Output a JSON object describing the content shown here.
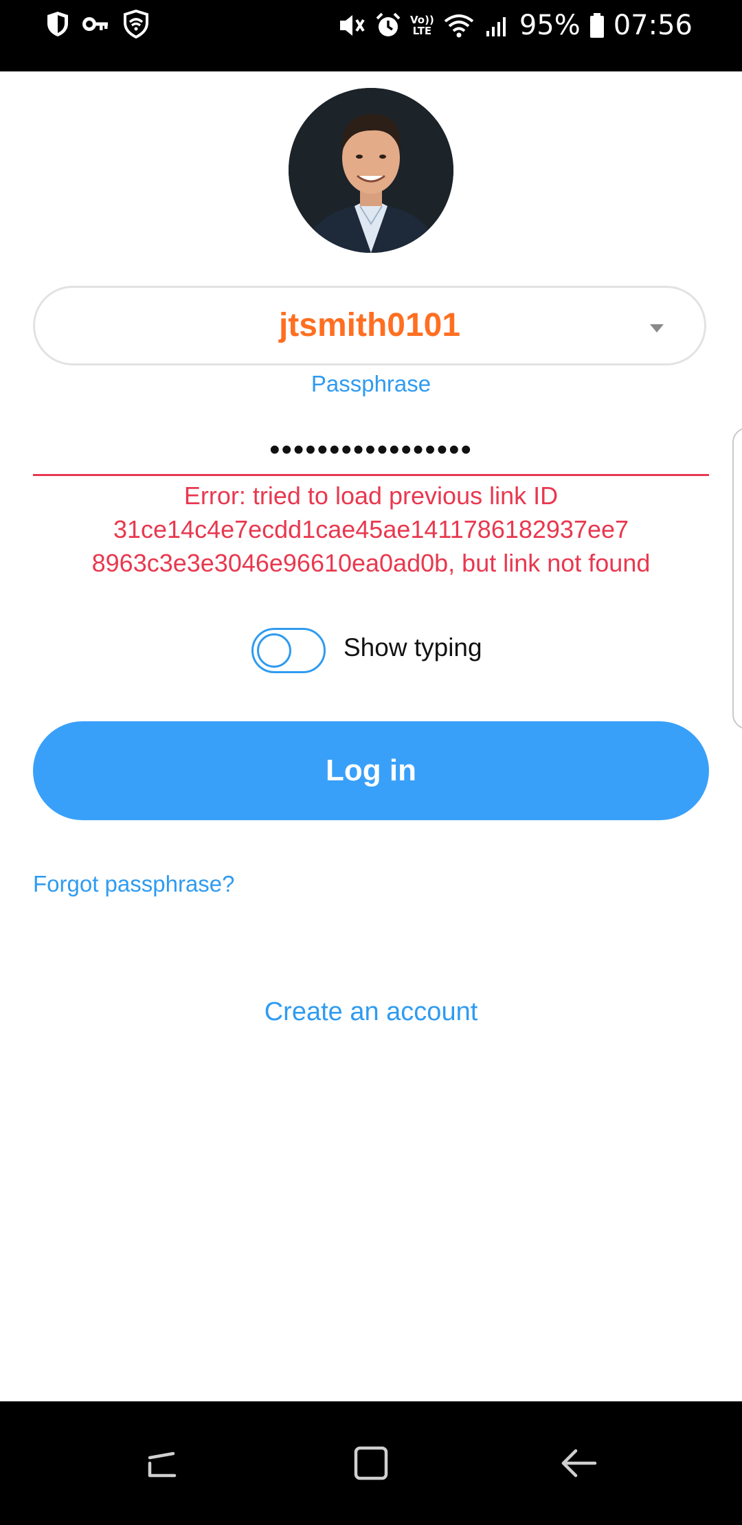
{
  "status_bar": {
    "battery": "95%",
    "time": "07:56",
    "volte_top": "Vo))",
    "volte_bottom": "LTE",
    "left_icons": [
      "shield-icon",
      "key-icon",
      "vpn-shield-icon"
    ],
    "right_icons": [
      "mute-icon",
      "alarm-icon",
      "volte-icon",
      "wifi-icon",
      "signal-icon",
      "battery-icon"
    ]
  },
  "login": {
    "username": "jtsmith0101",
    "passphrase_label": "Passphrase",
    "passphrase_value": "•••••••••••••••••",
    "error": "Error: tried to load previous link ID 31ce14c4e7ecdd1cae45ae1411786182937ee7 8963c3e3e3046e96610ea0ad0b, but link not found",
    "show_typing_label": "Show typing",
    "show_typing_enabled": false,
    "login_button": "Log in",
    "forgot_link": "Forgot passphrase?",
    "create_account_link": "Create an account"
  },
  "colors": {
    "accent_blue": "#39a0fa",
    "username_orange": "#ff6f21",
    "error_red": "#e8384f"
  },
  "nav_bar": {
    "buttons": [
      "recent-apps-icon",
      "home-icon",
      "back-icon"
    ]
  }
}
